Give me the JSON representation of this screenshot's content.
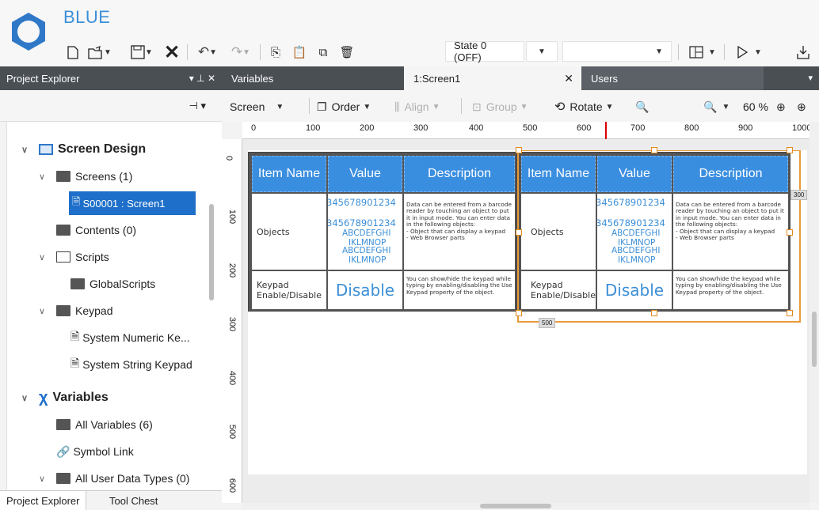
{
  "app": {
    "title": "BLUE"
  },
  "toolbar": {
    "state_label": "State 0 (OFF)",
    "blank_select": ""
  },
  "project_explorer": {
    "header": "Project Explorer",
    "pin_glyph": "▾ ⊥ ✕",
    "tree": {
      "screen_design": "Screen Design",
      "screens": "Screens (1)",
      "screen1": "S00001 : Screen1",
      "contents": "Contents (0)",
      "scripts": "Scripts",
      "global_scripts": "GlobalScripts",
      "keypad": "Keypad",
      "numeric_keypad": "System Numeric Ke...",
      "string_keypad": "System String Keypad",
      "variables": "Variables",
      "all_variables": "All Variables (6)",
      "symbol_link": "Symbol Link",
      "user_data_types": "All User Data Types (0)"
    },
    "bottom_tabs": [
      "Project Explorer",
      "Tool Chest"
    ]
  },
  "doc_tabs": {
    "variables": "Variables",
    "screen1": "1:Screen1",
    "users": "Users"
  },
  "editor_toolbar": {
    "screen": "Screen",
    "order": "Order",
    "align": "Align",
    "group": "Group",
    "rotate": "Rotate",
    "zoom": "60 %"
  },
  "ruler_h": [
    "0",
    "100",
    "200",
    "300",
    "400",
    "500",
    "600",
    "700",
    "800",
    "900",
    "1000"
  ],
  "ruler_v": [
    "0",
    "100",
    "200",
    "300",
    "400",
    "500",
    "600"
  ],
  "table": {
    "headers": [
      "Item Name",
      "Value",
      "Description"
    ],
    "row1_name": "Objects",
    "row1_values": [
      "345678901234",
      "345678901234",
      "ABCDEFGHI",
      "IKLMNOP",
      "ABCDEFGHI",
      "IKLMNOP"
    ],
    "row1_desc": "Data can be entered from a barcode reader by touching an object to put it in input mode. You can enter data in the following objects:\n- Object that can display a keypad\n- Web Browser parts",
    "row2_name": "Keypad Enable/Disable",
    "row2_value": "Disable",
    "row2_desc": "You can show/hide the keypad while typing by enabling/disabling the Use Keypad property of the object."
  },
  "dimensions": {
    "height_label": "300",
    "width_label": "500"
  },
  "colors": {
    "accent": "#3a8ee0",
    "panel_header": "#4a4f54",
    "selection": "#e89b3a"
  }
}
